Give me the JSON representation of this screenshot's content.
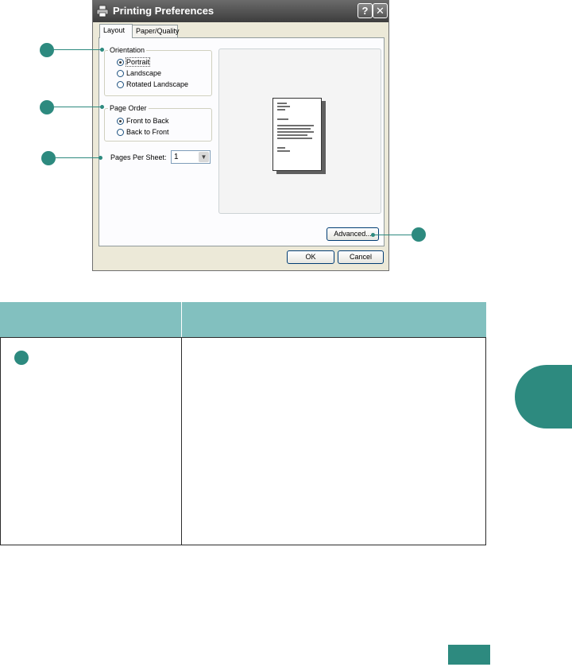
{
  "dialog": {
    "title": "Printing Preferences",
    "help_label": "?",
    "close_label": "✕",
    "tabs": [
      {
        "label": "Layout",
        "active": true
      },
      {
        "label": "Paper/Quality",
        "active": false
      }
    ],
    "orientation": {
      "title": "Orientation",
      "options": [
        {
          "label": "Portrait",
          "selected": true
        },
        {
          "label": "Landscape",
          "selected": false
        },
        {
          "label": "Rotated Landscape",
          "selected": false
        }
      ]
    },
    "page_order": {
      "title": "Page Order",
      "options": [
        {
          "label": "Front to Back",
          "selected": true
        },
        {
          "label": "Back to Front",
          "selected": false
        }
      ]
    },
    "pages_per_sheet": {
      "label": "Pages Per Sheet:",
      "value": "1"
    },
    "advanced_label": "Advanced...",
    "ok_label": "OK",
    "cancel_label": "Cancel"
  },
  "colors": {
    "accent": "#2d8a7f",
    "table_header": "#82c0bf"
  },
  "icons": [
    "printer-icon",
    "chevron-down-icon",
    "help-icon",
    "close-icon"
  ]
}
